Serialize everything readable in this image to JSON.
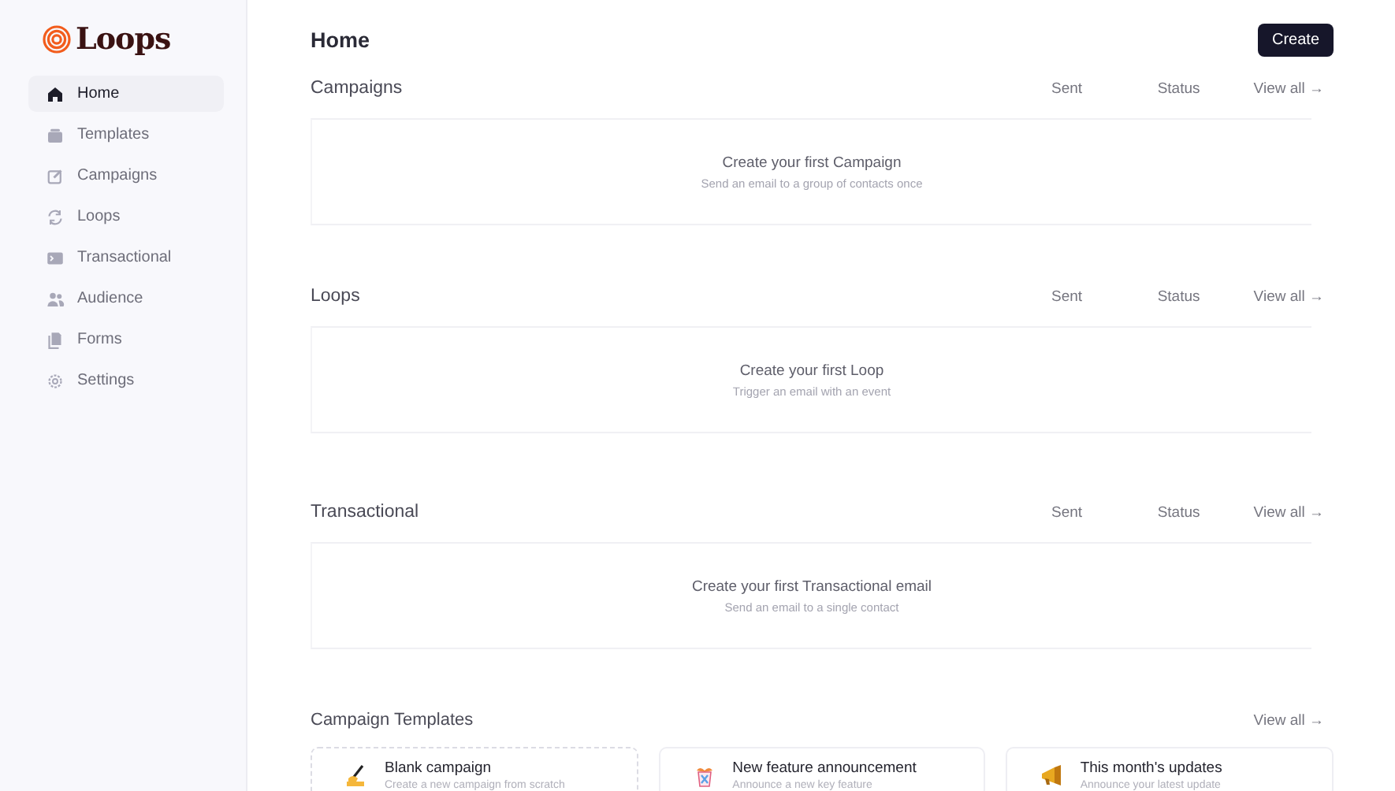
{
  "logo": {
    "text": "Loops"
  },
  "sidebar": {
    "items": [
      {
        "label": "Home",
        "selected": true
      },
      {
        "label": "Templates",
        "selected": false
      },
      {
        "label": "Campaigns",
        "selected": false
      },
      {
        "label": "Loops",
        "selected": false
      },
      {
        "label": "Transactional",
        "selected": false
      },
      {
        "label": "Audience",
        "selected": false
      },
      {
        "label": "Forms",
        "selected": false
      },
      {
        "label": "Settings",
        "selected": false
      }
    ]
  },
  "page": {
    "title": "Home",
    "create_button": "Create"
  },
  "sections": [
    {
      "title": "Campaigns",
      "columns": [
        "Sent",
        "Status"
      ],
      "view_all": "View all →",
      "empty_title": "Create your first Campaign",
      "empty_subtitle": "Send an email to a group of contacts once"
    },
    {
      "title": "Loops",
      "columns": [
        "Sent",
        "Status"
      ],
      "view_all": "View all →",
      "empty_title": "Create your first Loop",
      "empty_subtitle": "Trigger an email with an event"
    },
    {
      "title": "Transactional",
      "columns": [
        "Sent",
        "Status"
      ],
      "view_all": "View all →",
      "empty_title": "Create your first Transactional email",
      "empty_subtitle": "Send an email to a single contact"
    }
  ],
  "templates": {
    "title": "Campaign Templates",
    "view_all": "View all →",
    "cards": [
      {
        "kind": "blank",
        "title": "Blank campaign",
        "subtitle": "Create a new campaign from scratch"
      },
      {
        "kind": "template",
        "title": "New feature announcement",
        "subtitle": "Announce a new key feature"
      },
      {
        "kind": "template",
        "title": "This month's updates",
        "subtitle": "Announce your latest update"
      }
    ]
  }
}
